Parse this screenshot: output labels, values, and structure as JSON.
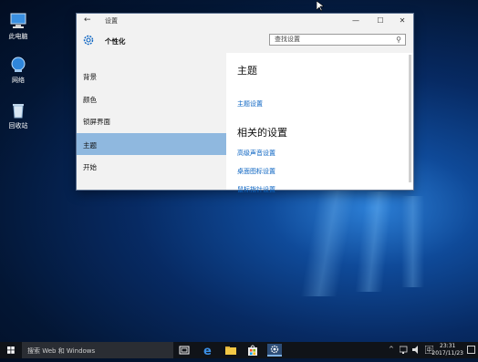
{
  "desktop": {
    "icons": [
      {
        "label": "此电脑",
        "icon": "computer-icon"
      },
      {
        "label": "网络",
        "icon": "network-icon"
      },
      {
        "label": "回收站",
        "icon": "recycle-bin-icon"
      }
    ]
  },
  "window": {
    "back_glyph": "←",
    "title": "设置",
    "minimize_glyph": "—",
    "maximize_glyph": "☐",
    "close_glyph": "✕",
    "page_title": "个性化",
    "search_placeholder": "查找设置",
    "search_glyph": "⚲"
  },
  "sidebar": {
    "items": [
      {
        "label": "背景",
        "active": false
      },
      {
        "label": "颜色",
        "active": false
      },
      {
        "label": "锁屏界面",
        "active": false
      },
      {
        "label": "主题",
        "active": true
      },
      {
        "label": "开始",
        "active": false
      }
    ]
  },
  "content": {
    "heading": "主题",
    "theme_settings_link": "主题设置",
    "related_heading": "相关的设置",
    "links": [
      "高级声音设置",
      "桌面图标设置",
      "鼠标指针设置"
    ]
  },
  "taskbar": {
    "search_placeholder": "搜索 Web 和 Windows",
    "apps": [
      "task-view-icon",
      "edge-icon",
      "file-explorer-icon",
      "store-icon",
      "settings-icon"
    ],
    "time": "23:31",
    "date": "2017/11/23"
  },
  "colors": {
    "accent": "#8fb8df",
    "link": "#0a63c2",
    "taskbar": "#101318"
  }
}
